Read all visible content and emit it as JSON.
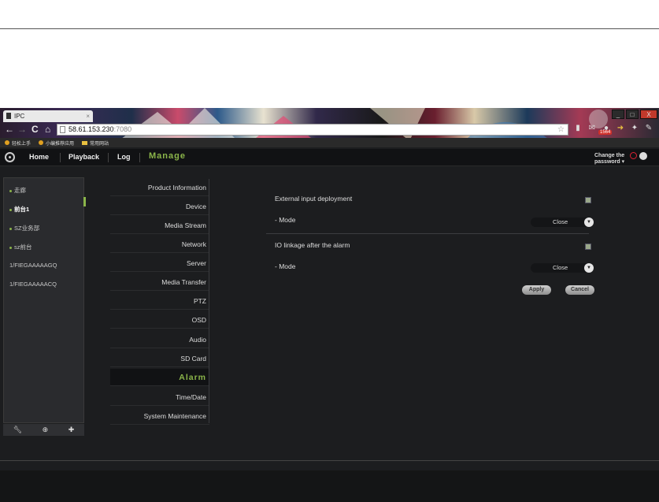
{
  "browser": {
    "tab_title": "IPC",
    "tab_close": "×",
    "url_host": "58.61.153.230",
    "url_port": ":7080",
    "window_controls": [
      "_",
      "□",
      "X"
    ],
    "nav_icons": [
      "back-arrow-icon",
      "forward-arrow-icon",
      "reload-icon",
      "home-icon"
    ],
    "mail_badge": "1564",
    "bookmarks": [
      {
        "label": "轻松上手",
        "icon": "bookmark-icon"
      },
      {
        "label": "小编推荐应用",
        "icon": "bookmark-icon"
      },
      {
        "label": "常用网站",
        "icon": "folder-icon"
      }
    ]
  },
  "app_nav": {
    "items": [
      "Home",
      "Playback",
      "Log"
    ],
    "active": "Manage",
    "change_password_line1": "Change the",
    "change_password_line2": "password ▾"
  },
  "left_tree": {
    "items": [
      "走廊",
      "前台1",
      "SZ业务部",
      "sz前台",
      "1/FIEGAAAAAGQ",
      "1/FIEGAAAAACQ"
    ],
    "active_index": 1,
    "tools": [
      "wrench-icon",
      "search-plus-icon",
      "add-icon"
    ]
  },
  "settings_menu": {
    "items": [
      "Product Information",
      "Device",
      "Media Stream",
      "Network",
      "Server",
      "Media Transfer",
      "PTZ",
      "OSD",
      "Audio",
      "SD Card",
      "Alarm",
      "Time/Date",
      "System Maintenance"
    ],
    "active": "Alarm"
  },
  "alarm": {
    "external_input_label": "External input deployment",
    "external_input_checked": true,
    "mode1_label": "- Mode",
    "mode1_value": "Close",
    "io_linkage_label": "IO linkage after the alarm",
    "io_linkage_checked": true,
    "mode2_label": "- Mode",
    "mode2_value": "Close",
    "apply_label": "Apply",
    "cancel_label": "Cancel"
  },
  "colors": {
    "accent": "#8bb54a",
    "background": "#1c1d1f"
  }
}
